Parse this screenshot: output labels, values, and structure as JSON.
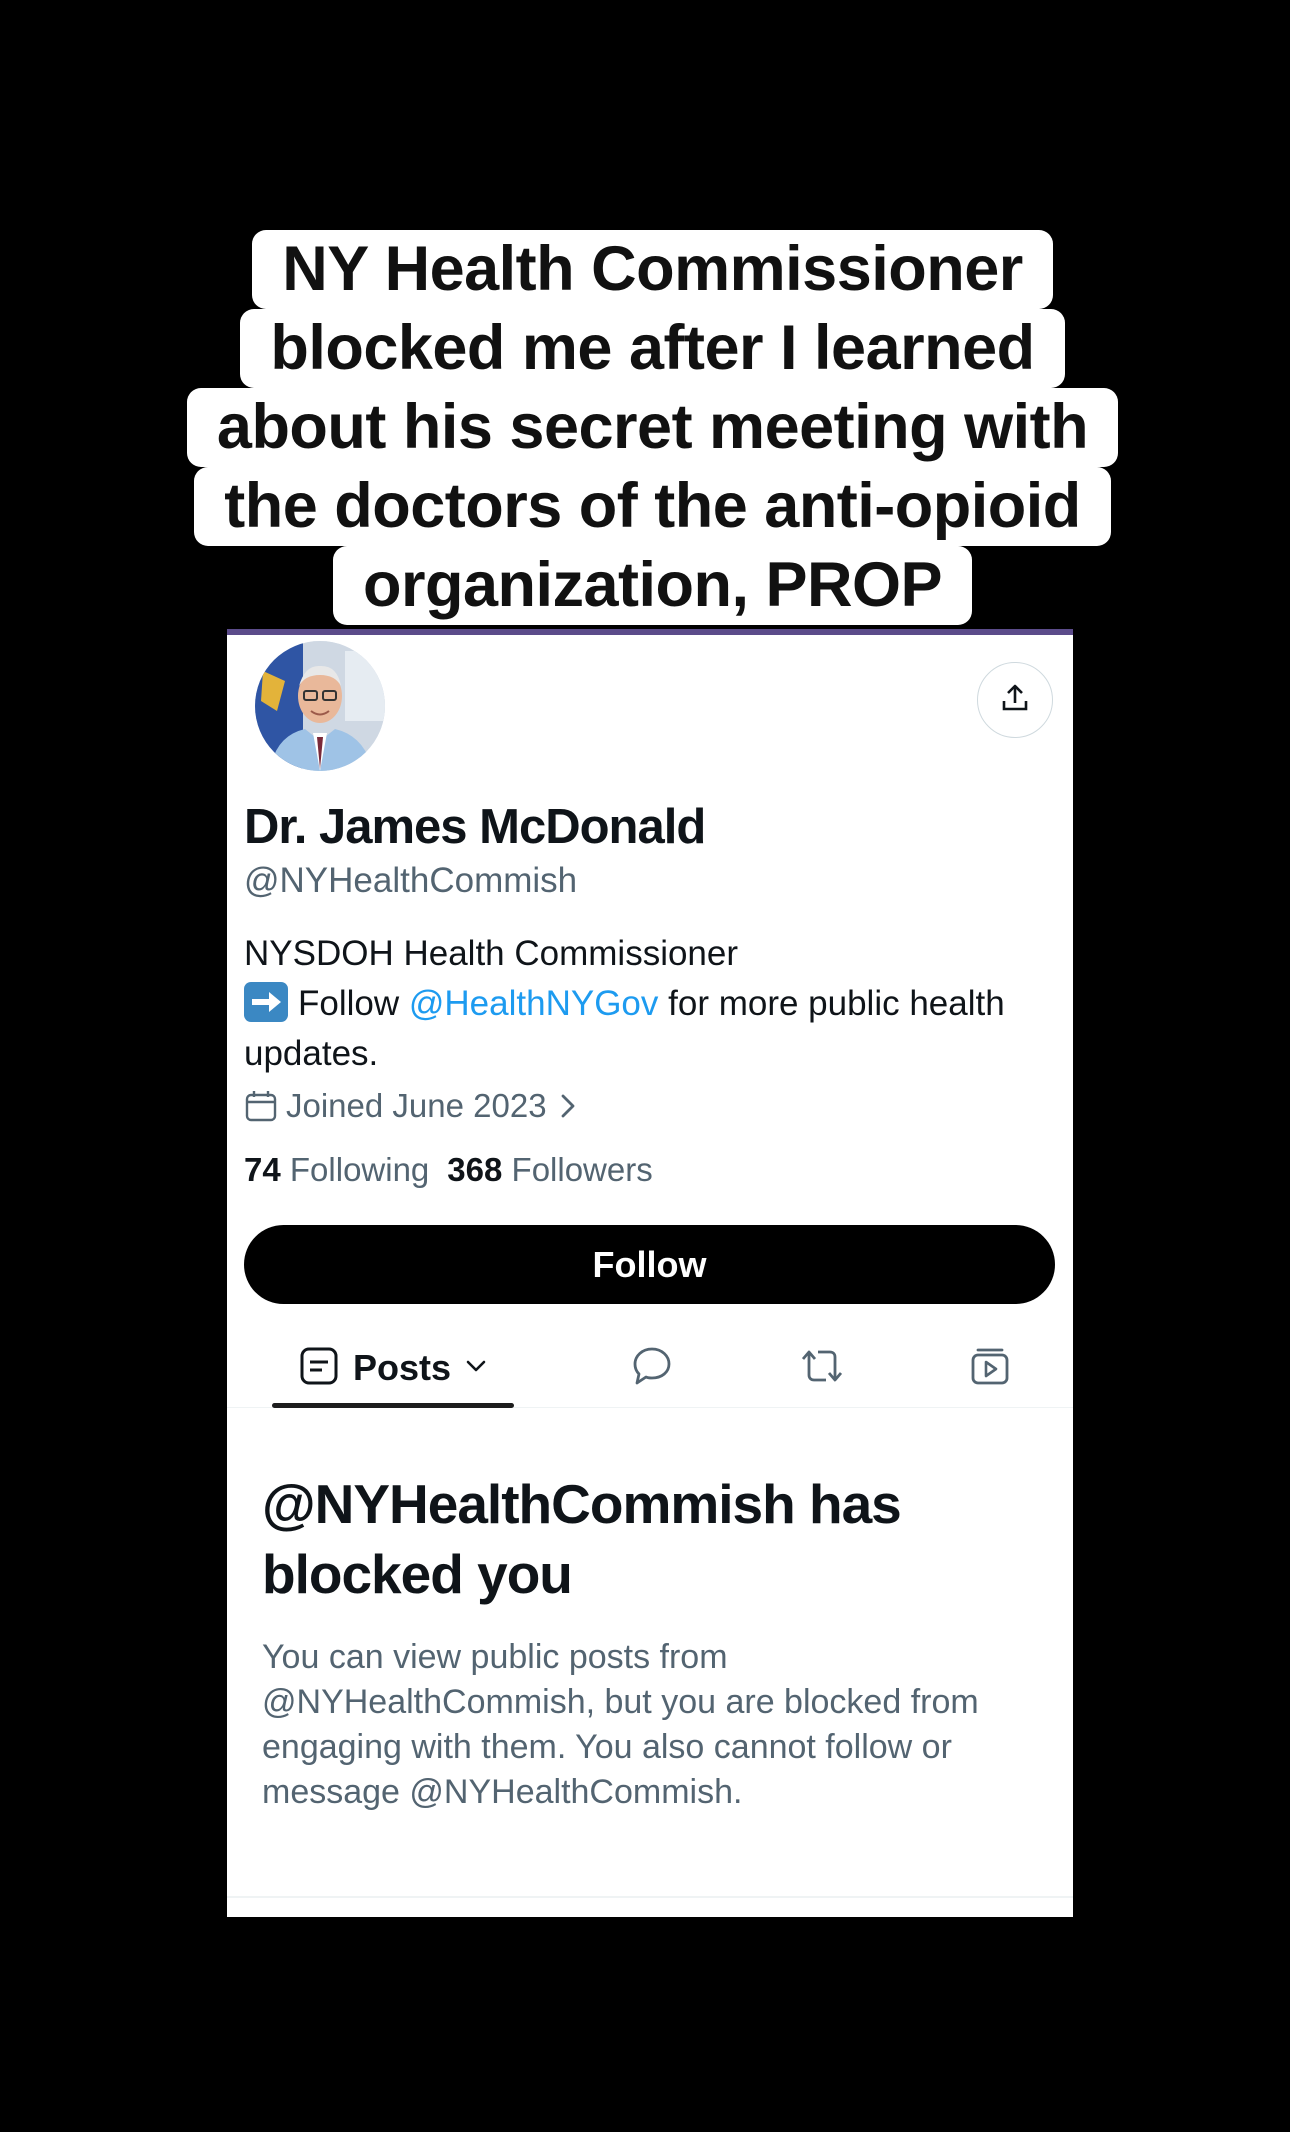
{
  "caption": {
    "lines": [
      "NY Health Commissioner",
      "blocked me after I learned",
      "about his secret meeting with",
      "the doctors of the anti-opioid",
      "organization, PROP"
    ]
  },
  "profile": {
    "display_name": "Dr. James McDonald",
    "handle": "@NYHealthCommish",
    "bio_line1": "NYSDOH Health Commissioner",
    "bio_follow_word": "Follow",
    "bio_mention": "@HealthNYGov",
    "bio_rest": "for more public health",
    "bio_line3": "updates.",
    "joined": "Joined June 2023",
    "following_count": "74",
    "following_label": "Following",
    "followers_count": "368",
    "followers_label": "Followers",
    "follow_button": "Follow"
  },
  "tabs": {
    "posts_label": "Posts"
  },
  "blocked": {
    "title": "@NYHealthCommish has blocked you",
    "description": "You can view public posts from @NYHealthCommish, but you are blocked from engaging with them. You also cannot follow or message @NYHealthCommish."
  },
  "colors": {
    "accent_link": "#1d9bf0",
    "secondary_text": "#536471",
    "primary_text": "#0f1419",
    "follow_button_bg": "#000000",
    "header_accent": "#5b4b8a"
  },
  "icons": {
    "share": "share-icon",
    "calendar": "calendar-icon",
    "chevron": "chevron-right-icon",
    "posts": "posts-icon",
    "replies": "speech-bubble-icon",
    "reposts": "repost-icon",
    "media": "media-icon",
    "bio_emoji": "right-arrow-emoji-icon"
  }
}
